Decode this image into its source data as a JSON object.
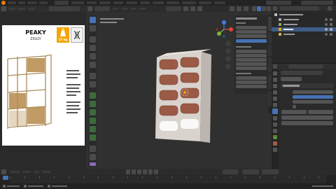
{
  "colors": {
    "bg": "#1d1d1d",
    "viewport": "#303030",
    "panel": "#2b2b2b",
    "accent_blue": "#4772b3",
    "accent_orange": "#f5a300",
    "selected_row": "#3e5c86",
    "object_cream": "#d9d3ce",
    "object_brown": "#9b5a45"
  },
  "ref_image": {
    "title": "PEAKY",
    "subtitle": "ZIGGY",
    "weight_badge": "25 kg"
  },
  "icons": {
    "app_logo": "blender-logo-icon",
    "gizmo": "navigation-gizmo-icon",
    "hand": "hand-icon",
    "camera": "camera-icon",
    "grid": "grid-icon",
    "cursor": "3d-cursor-icon"
  }
}
